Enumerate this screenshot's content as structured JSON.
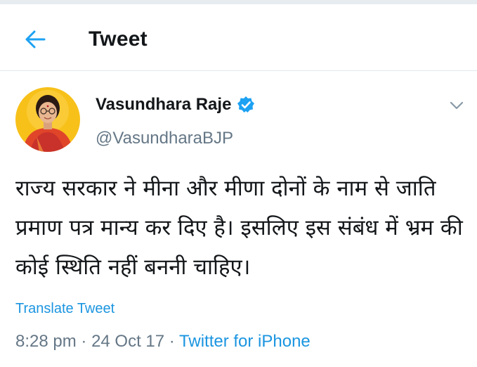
{
  "header": {
    "title": "Tweet"
  },
  "tweet": {
    "author_name": "Vasundhara Raje",
    "handle": "@VasundharaBJP",
    "text": "राज्य सरकार ने मीना और मीणा दोनों के नाम से जाति प्रमाण पत्र मान्य कर दिए है। इसलिए इस संबंध में भ्रम की कोई स्थिति नहीं बननी चाहिए।",
    "translate_label": "Translate Tweet",
    "time": "8:28 pm",
    "date": "24 Oct 17",
    "source": "Twitter for iPhone",
    "separator": "·"
  },
  "colors": {
    "accent": "#1da1f2",
    "link": "#1b95e0",
    "text_primary": "#14171a",
    "text_secondary": "#657786",
    "avatar_bg": "#f7c11a",
    "divider": "#e1e8ed"
  },
  "icons": {
    "back": "arrow-left-icon",
    "verified": "verified-badge-icon",
    "caret": "chevron-down-icon"
  }
}
